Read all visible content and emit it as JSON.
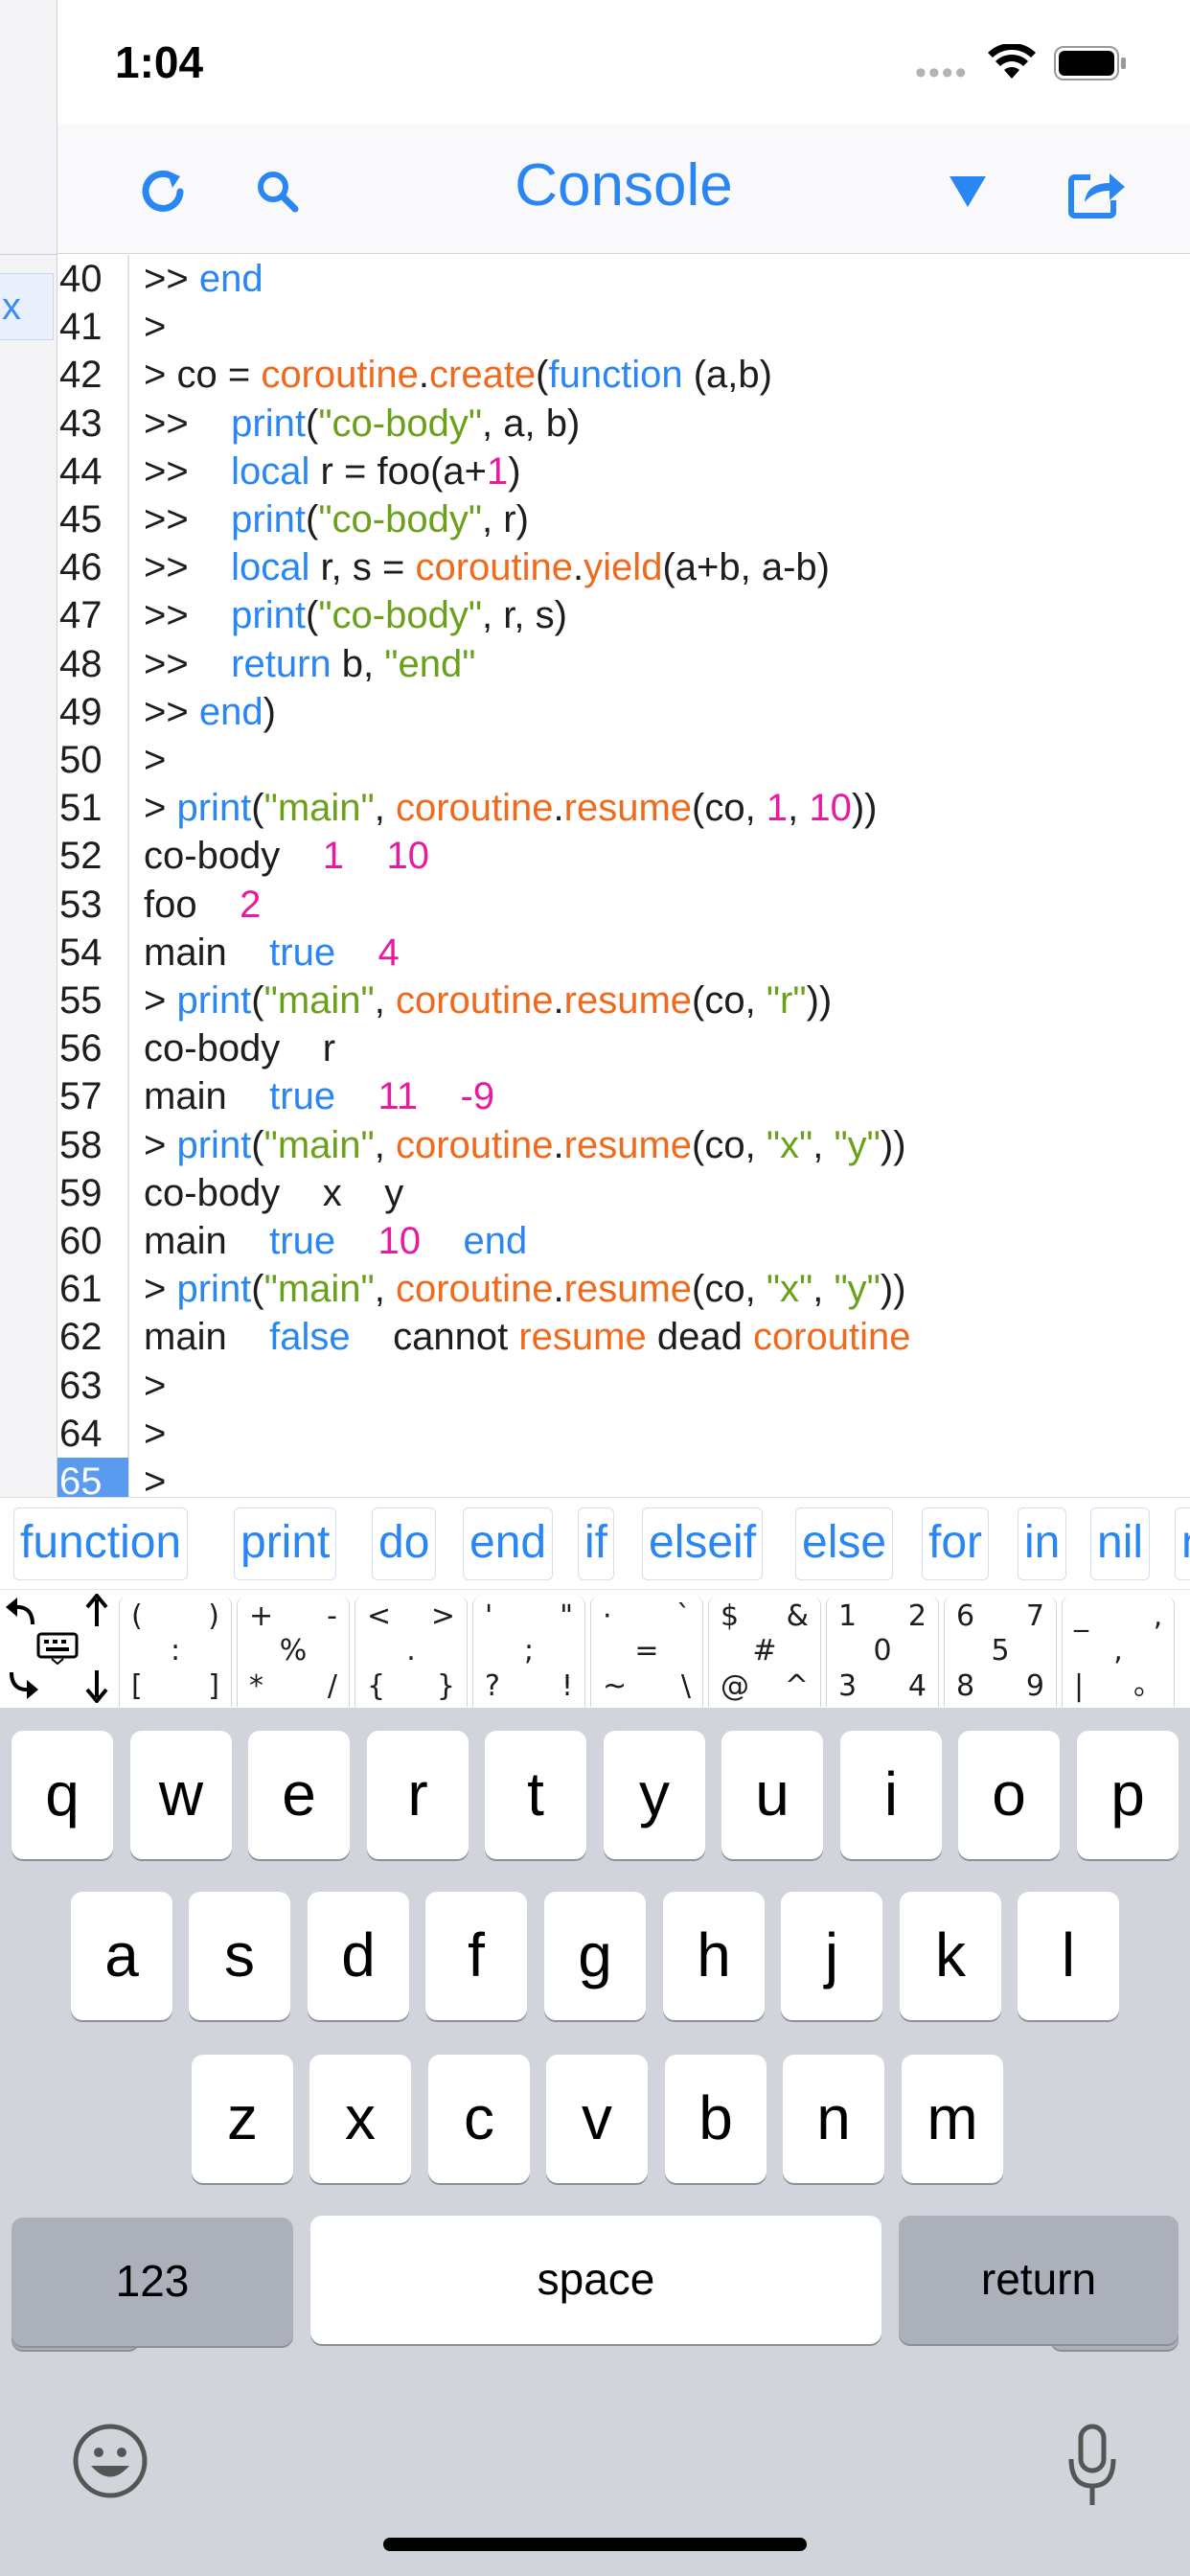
{
  "status_bar": {
    "time": "1:04"
  },
  "nav": {
    "title": "Console"
  },
  "left_panel": {
    "close_label": "x"
  },
  "console_lines": [
    {
      "num": "40",
      "segs": [
        [
          ">> ",
          ""
        ],
        [
          "end",
          "kw"
        ]
      ]
    },
    {
      "num": "41",
      "segs": [
        [
          ">",
          ""
        ]
      ]
    },
    {
      "num": "42",
      "segs": [
        [
          "> co = ",
          ""
        ],
        [
          "coroutine",
          "fn"
        ],
        [
          ".",
          ""
        ],
        [
          "create",
          "fn"
        ],
        [
          "(",
          ""
        ],
        [
          "function",
          "kw"
        ],
        [
          " (a,b)",
          ""
        ]
      ]
    },
    {
      "num": "43",
      "segs": [
        [
          ">>    ",
          ""
        ],
        [
          "print",
          "kw"
        ],
        [
          "(",
          ""
        ],
        [
          "\"co-body\"",
          "str"
        ],
        [
          ", a, b)",
          ""
        ]
      ]
    },
    {
      "num": "44",
      "segs": [
        [
          ">>    ",
          ""
        ],
        [
          "local",
          "kw"
        ],
        [
          " r = foo(a+",
          ""
        ],
        [
          "1",
          "num"
        ],
        [
          ")",
          ""
        ]
      ]
    },
    {
      "num": "45",
      "segs": [
        [
          ">>    ",
          ""
        ],
        [
          "print",
          "kw"
        ],
        [
          "(",
          ""
        ],
        [
          "\"co-body\"",
          "str"
        ],
        [
          ", r)",
          ""
        ]
      ]
    },
    {
      "num": "46",
      "segs": [
        [
          ">>    ",
          ""
        ],
        [
          "local",
          "kw"
        ],
        [
          " r, s = ",
          ""
        ],
        [
          "coroutine",
          "fn"
        ],
        [
          ".",
          ""
        ],
        [
          "yield",
          "fn"
        ],
        [
          "(a+b, a-b)",
          ""
        ]
      ]
    },
    {
      "num": "47",
      "segs": [
        [
          ">>    ",
          ""
        ],
        [
          "print",
          "kw"
        ],
        [
          "(",
          ""
        ],
        [
          "\"co-body\"",
          "str"
        ],
        [
          ", r, s)",
          ""
        ]
      ]
    },
    {
      "num": "48",
      "segs": [
        [
          ">>    ",
          ""
        ],
        [
          "return",
          "kw"
        ],
        [
          " b, ",
          ""
        ],
        [
          "\"end\"",
          "str"
        ]
      ]
    },
    {
      "num": "49",
      "segs": [
        [
          ">> ",
          ""
        ],
        [
          "end",
          "kw"
        ],
        [
          ")",
          ""
        ]
      ]
    },
    {
      "num": "50",
      "segs": [
        [
          ">",
          ""
        ]
      ]
    },
    {
      "num": "51",
      "segs": [
        [
          "> ",
          ""
        ],
        [
          "print",
          "kw"
        ],
        [
          "(",
          ""
        ],
        [
          "\"main\"",
          "str"
        ],
        [
          ", ",
          ""
        ],
        [
          "coroutine",
          "fn"
        ],
        [
          ".",
          ""
        ],
        [
          "resume",
          "fn"
        ],
        [
          "(co, ",
          ""
        ],
        [
          "1",
          "num"
        ],
        [
          ", ",
          ""
        ],
        [
          "10",
          "num"
        ],
        [
          "))",
          ""
        ]
      ]
    },
    {
      "num": "52",
      "segs": [
        [
          "co-body    ",
          ""
        ],
        [
          "1",
          "num"
        ],
        [
          "    ",
          ""
        ],
        [
          "10",
          "num"
        ]
      ]
    },
    {
      "num": "53",
      "segs": [
        [
          "foo    ",
          ""
        ],
        [
          "2",
          "num"
        ]
      ]
    },
    {
      "num": "54",
      "segs": [
        [
          "main    ",
          ""
        ],
        [
          "true",
          "kw"
        ],
        [
          "    ",
          ""
        ],
        [
          "4",
          "num"
        ]
      ]
    },
    {
      "num": "55",
      "segs": [
        [
          "> ",
          ""
        ],
        [
          "print",
          "kw"
        ],
        [
          "(",
          ""
        ],
        [
          "\"main\"",
          "str"
        ],
        [
          ", ",
          ""
        ],
        [
          "coroutine",
          "fn"
        ],
        [
          ".",
          ""
        ],
        [
          "resume",
          "fn"
        ],
        [
          "(co, ",
          ""
        ],
        [
          "\"r\"",
          "str"
        ],
        [
          "))",
          ""
        ]
      ]
    },
    {
      "num": "56",
      "segs": [
        [
          "co-body    r",
          ""
        ]
      ]
    },
    {
      "num": "57",
      "segs": [
        [
          "main    ",
          ""
        ],
        [
          "true",
          "kw"
        ],
        [
          "    ",
          ""
        ],
        [
          "11",
          "num"
        ],
        [
          "    ",
          ""
        ],
        [
          "-9",
          "num"
        ]
      ]
    },
    {
      "num": "58",
      "segs": [
        [
          "> ",
          ""
        ],
        [
          "print",
          "kw"
        ],
        [
          "(",
          ""
        ],
        [
          "\"main\"",
          "str"
        ],
        [
          ", ",
          ""
        ],
        [
          "coroutine",
          "fn"
        ],
        [
          ".",
          ""
        ],
        [
          "resume",
          "fn"
        ],
        [
          "(co, ",
          ""
        ],
        [
          "\"x\"",
          "str"
        ],
        [
          ", ",
          ""
        ],
        [
          "\"y\"",
          "str"
        ],
        [
          "))",
          ""
        ]
      ]
    },
    {
      "num": "59",
      "segs": [
        [
          "co-body    x    y",
          ""
        ]
      ]
    },
    {
      "num": "60",
      "segs": [
        [
          "main    ",
          ""
        ],
        [
          "true",
          "kw"
        ],
        [
          "    ",
          ""
        ],
        [
          "10",
          "num"
        ],
        [
          "    ",
          ""
        ],
        [
          "end",
          "kw"
        ]
      ]
    },
    {
      "num": "61",
      "segs": [
        [
          "> ",
          ""
        ],
        [
          "print",
          "kw"
        ],
        [
          "(",
          ""
        ],
        [
          "\"main\"",
          "str"
        ],
        [
          ", ",
          ""
        ],
        [
          "coroutine",
          "fn"
        ],
        [
          ".",
          ""
        ],
        [
          "resume",
          "fn"
        ],
        [
          "(co, ",
          ""
        ],
        [
          "\"x\"",
          "str"
        ],
        [
          ", ",
          ""
        ],
        [
          "\"y\"",
          "str"
        ],
        [
          "))",
          ""
        ]
      ]
    },
    {
      "num": "62",
      "segs": [
        [
          "main    ",
          ""
        ],
        [
          "false",
          "kw"
        ],
        [
          "    cannot ",
          ""
        ],
        [
          "resume",
          "fn"
        ],
        [
          " dead ",
          ""
        ],
        [
          "coroutine",
          "fn"
        ]
      ]
    },
    {
      "num": "63",
      "segs": [
        [
          ">",
          ""
        ]
      ]
    },
    {
      "num": "64",
      "segs": [
        [
          ">",
          ""
        ]
      ]
    },
    {
      "num": "65",
      "segs": [
        [
          ">",
          ""
        ]
      ],
      "current": true
    }
  ],
  "suggestions": [
    "function",
    "print",
    "do",
    "end",
    "if",
    "elseif",
    "else",
    "for",
    "in",
    "nil",
    "n"
  ],
  "symbol_keys": [
    {
      "tl": "(",
      "tr": ")",
      "c": ":",
      "bl": "[",
      "br": "]"
    },
    {
      "tl": "+",
      "tr": "-",
      "c": "%",
      "bl": "*",
      "br": "/"
    },
    {
      "tl": "<",
      "tr": ">",
      "c": ".",
      "bl": "{",
      "br": "}"
    },
    {
      "tl": "'",
      "tr": "\"",
      "c": ";",
      "bl": "?",
      "br": "!"
    },
    {
      "tl": "·",
      "tr": "`",
      "c": "=",
      "bl": "~",
      "br": "\\"
    },
    {
      "tl": "$",
      "tr": "&",
      "c": "#",
      "bl": "@",
      "br": "^"
    },
    {
      "tl": "1",
      "tr": "2",
      "c": "0",
      "bl": "3",
      "br": "4"
    },
    {
      "tl": "6",
      "tr": "7",
      "c": "5",
      "bl": "8",
      "br": "9"
    },
    {
      "tl": "_",
      "tr": "‚",
      "c": ",",
      "bl": "|",
      "br": "。"
    }
  ],
  "keyboard": {
    "row1": [
      "q",
      "w",
      "e",
      "r",
      "t",
      "y",
      "u",
      "i",
      "o",
      "p"
    ],
    "row2": [
      "a",
      "s",
      "d",
      "f",
      "g",
      "h",
      "j",
      "k",
      "l"
    ],
    "row3": [
      "z",
      "x",
      "c",
      "v",
      "b",
      "n",
      "m"
    ],
    "numbers_label": "123",
    "space_label": "space",
    "return_label": "return"
  },
  "colors": {
    "accent": "#2a86f2",
    "keyword": "#2a86f2",
    "function": "#f06a1e",
    "string": "#6ba01c",
    "number": "#e81aa0"
  }
}
